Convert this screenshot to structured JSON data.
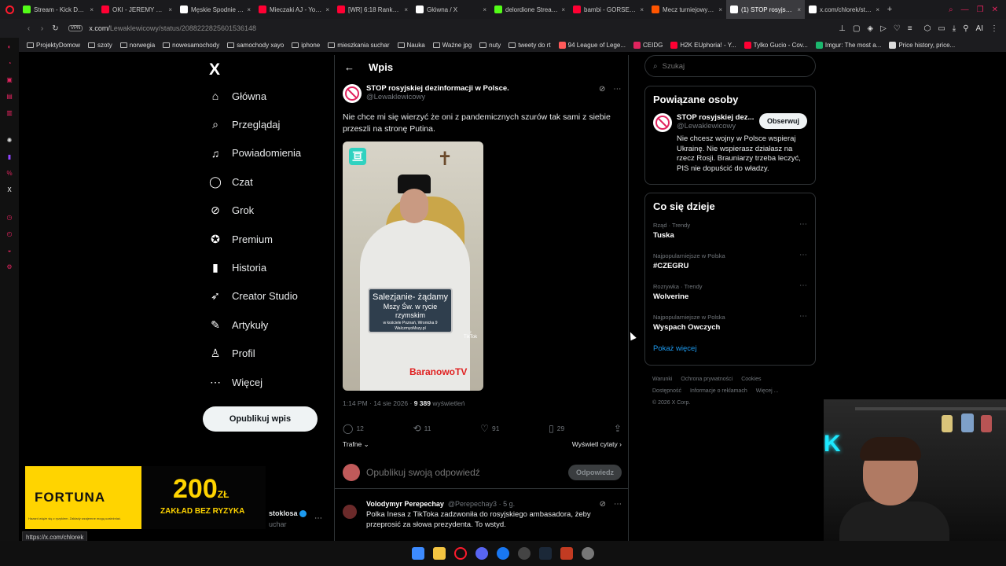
{
  "browser": {
    "tabs": [
      {
        "label": "Stream - Kick Dashbo",
        "color": "#53fc18"
      },
      {
        "label": "OKI - JEREMY SOCHA",
        "color": "#ff0033"
      },
      {
        "label": "Męskie Spodnie THE",
        "color": "#ffffff"
      },
      {
        "label": "Mieczaki AJ - YouTub",
        "color": "#ff0033"
      },
      {
        "label": "[WR] 6:18 Ranked Bu",
        "color": "#ff0033"
      },
      {
        "label": "Główna / X",
        "color": "#ffffff"
      },
      {
        "label": "delordione Stream - V",
        "color": "#53fc18"
      },
      {
        "label": "bambi - GORSET - Yo",
        "color": "#ff0033"
      },
      {
        "label": "Mecz turniejowy FACE",
        "color": "#ff5500"
      },
      {
        "label": "(1) STOP rosyjskiej dez",
        "color": "#ffffff",
        "active": true
      },
      {
        "label": "x.com/chlorek/status/",
        "color": "#ffffff"
      }
    ],
    "url_domain": "x.com/",
    "url_path": "Lewaklewicowy/status/2088222825601536148",
    "vpn_label": "VPN",
    "ai_label": "AI",
    "bookmarks": [
      {
        "label": "ProjektyDomow",
        "type": "folder"
      },
      {
        "label": "szoty",
        "type": "folder"
      },
      {
        "label": "norwegia",
        "type": "folder"
      },
      {
        "label": "nowesamochody",
        "type": "folder"
      },
      {
        "label": "samochody xayo",
        "type": "folder"
      },
      {
        "label": "iphone",
        "type": "folder"
      },
      {
        "label": "mieszkania suchar",
        "type": "folder"
      },
      {
        "label": "Nauka",
        "type": "folder"
      },
      {
        "label": "Ważne jpg",
        "type": "folder"
      },
      {
        "label": "nuty",
        "type": "folder"
      },
      {
        "label": "tweety do rt",
        "type": "folder"
      },
      {
        "label": "94 League of Lege...",
        "type": "site",
        "color": "#ff5a5a"
      },
      {
        "label": "CEIDG",
        "type": "site",
        "color": "#e0245e"
      },
      {
        "label": "H2K EUphoria! - Y...",
        "type": "site",
        "color": "#ff0033"
      },
      {
        "label": "Tylko Gucio - Cov...",
        "type": "site",
        "color": "#ff0033"
      },
      {
        "label": "Imgur: The most a...",
        "type": "site",
        "color": "#1bb76e"
      },
      {
        "label": "Price history, price...",
        "type": "site",
        "color": "#dddddd"
      }
    ],
    "status_url": "https://x.com/chlorek"
  },
  "nav": {
    "logo": "X",
    "items": [
      {
        "label": "Główna",
        "icon": "⌂"
      },
      {
        "label": "Przeglądaj",
        "icon": "⌕"
      },
      {
        "label": "Powiadomienia",
        "icon": "♫"
      },
      {
        "label": "Czat",
        "icon": "◯"
      },
      {
        "label": "Grok",
        "icon": "⊘"
      },
      {
        "label": "Premium",
        "icon": "✪"
      },
      {
        "label": "Historia",
        "icon": "▮"
      },
      {
        "label": "Creator Studio",
        "icon": "➶"
      },
      {
        "label": "Artykuły",
        "icon": "✎"
      },
      {
        "label": "Profil",
        "icon": "♙"
      },
      {
        "label": "Więcej",
        "icon": "⋯"
      }
    ],
    "post_button": "Opublikuj wpis",
    "account_name": "stoklosa",
    "account_handle": "uchar"
  },
  "ad": {
    "brand": "FORTUNA",
    "amount": "200",
    "currency": "ZŁ",
    "subtitle": "ZAKŁAD BEZ RYZYKA",
    "fineprint": "Hazard wiąże się z ryzykiem. Zakłady wzajemne mogą uzależniać."
  },
  "post": {
    "header_title": "Wpis",
    "author_name": "STOP rosyjskiej dezinformacji w Polsce.",
    "author_handle": "@Lewaklewicowy",
    "text": "Nie chce mi się wierzyć że oni z pandemicznych szurów tak sami z siebie przeszli na stronę Putina.",
    "image": {
      "sign_line1": "Salezjanie- żądamy",
      "sign_line2": "Mszy Św. w rycie rzymskim",
      "sign_line3": "w kościele Poznań, Wronicka 9",
      "sign_line4": "WalczmyoMszy.pl",
      "watermark": "BaranowoTV",
      "tiktok_label": "TikTok"
    },
    "time": "1:14 PM · 14 sie 2026 · ",
    "views": "9 389",
    "views_label": " wyświetleń",
    "replies": "12",
    "reposts": "11",
    "likes": "91",
    "bookmarks": "29",
    "sort_label": "Trafne",
    "quotes_label": "Wyświetl cytaty",
    "reply_placeholder": "Opublikuj swoją odpowiedź",
    "reply_button": "Odpowiedz"
  },
  "comment": {
    "author_name": "Volodymyr Perepechay",
    "author_handle": "@Perepechay3 · 5 g.",
    "text": "Polka Inesa z TikToka zadzwoniła do rosyjskiego ambasadora, żeby przeprosić za słowa prezydenta. To wstyd."
  },
  "right": {
    "search_placeholder": "Szukaj",
    "related_title": "Powiązane osoby",
    "related_name": "STOP rosyjskiej dez...",
    "related_handle": "@Lewaklewicowy",
    "related_bio": "Nie chcesz wojny w Polsce wspieraj Ukrainę. Nie wspierasz działasz na rzecz Rosji. Brauniarzy trzeba leczyć, PIS nie dopuścić do władzy.",
    "follow_button": "Obserwuj",
    "trends_title": "Co się dzieje",
    "trends": [
      {
        "context": "Rząd · Trendy",
        "name": "Tuska"
      },
      {
        "context": "Najpopularniejsze w Polska",
        "name": "#CZEGRU"
      },
      {
        "context": "Rozrywka · Trendy",
        "name": "Wolverine"
      },
      {
        "context": "Najpopularniejsze w Polska",
        "name": "Wyspach Owczych"
      }
    ],
    "show_more": "Pokaż więcej",
    "footer_row1": [
      "Warunki",
      "Ochrona prywatności",
      "Cookies"
    ],
    "footer_row2": [
      "Dostępność",
      "Informacje o reklamach",
      "Więcej ..."
    ],
    "copyright": "© 2026 X Corp."
  },
  "colors": {
    "accent": "#1d9bf0",
    "opera": "#ff1b2d",
    "fortuna": "#ffd400"
  }
}
